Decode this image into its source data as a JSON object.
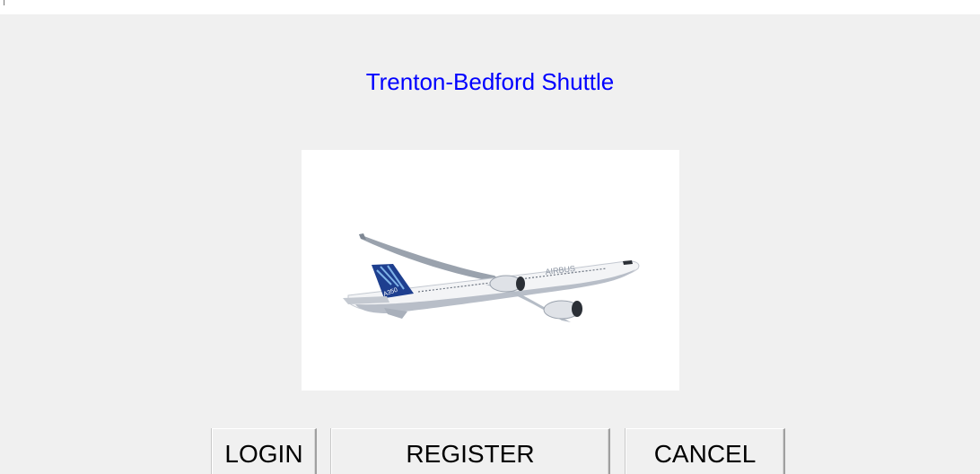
{
  "app": {
    "title": "Trenton-Bedford Shuttle"
  },
  "image": {
    "subject": "airplane-photo"
  },
  "buttons": {
    "login": "LOGIN",
    "register": "REGISTER",
    "cancel": "CANCEL"
  },
  "colors": {
    "title": "#0000ff",
    "background": "#f0f0f0",
    "image_background": "#ffffff",
    "tail_blue": "#1e3f8f"
  }
}
